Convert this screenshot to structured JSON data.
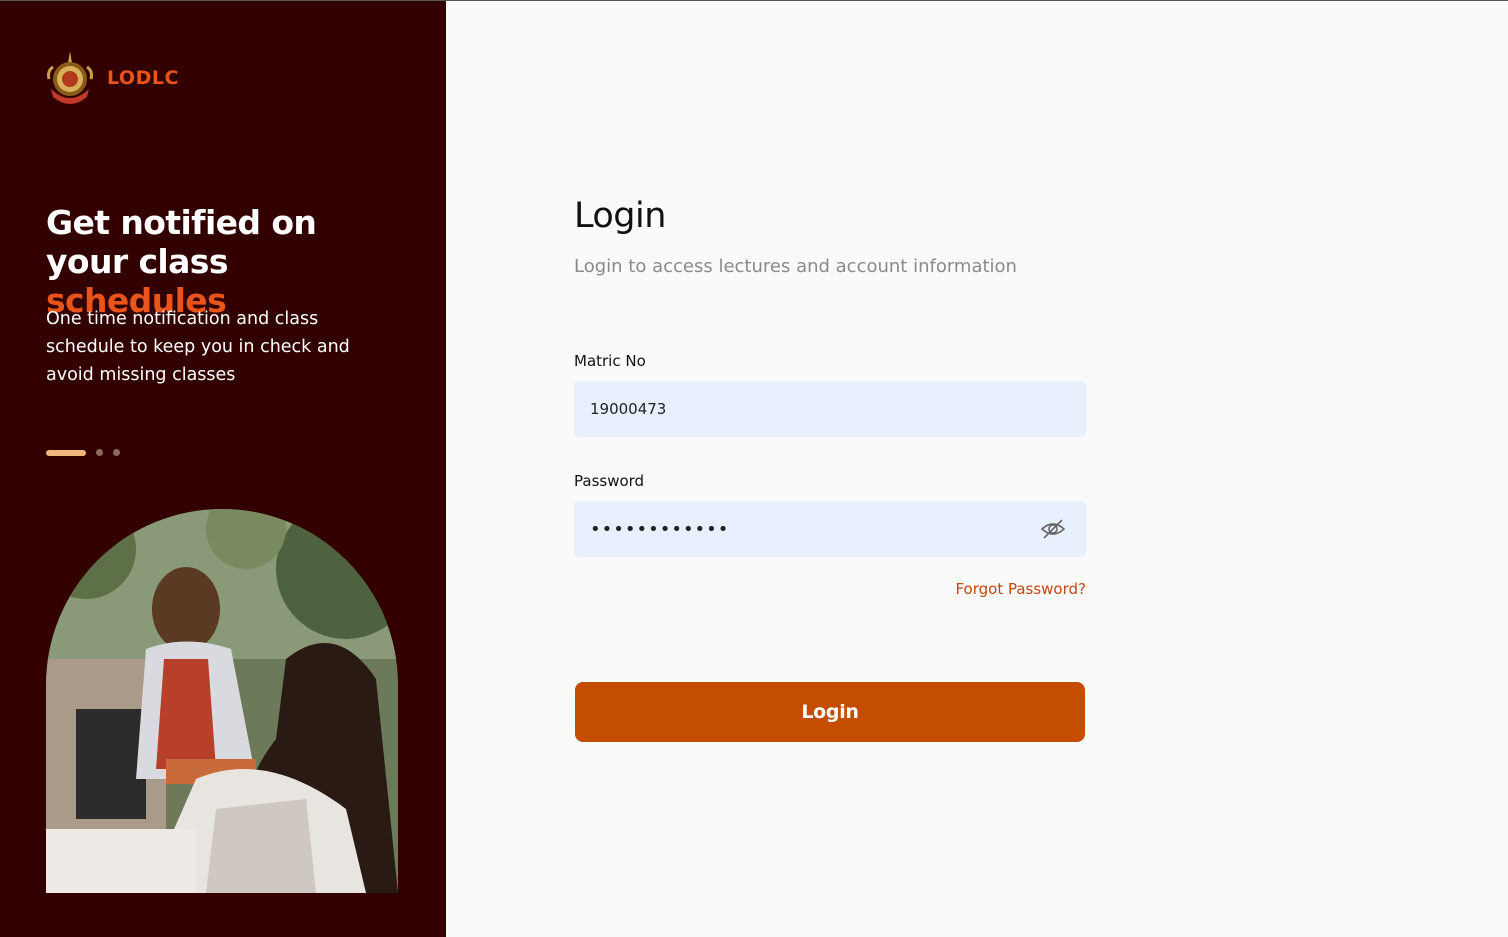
{
  "brand": {
    "name": "LODLC",
    "logo_icon": "crest-logo-icon"
  },
  "hero": {
    "headline_part1": "Get notified on your class ",
    "headline_accent": "schedules",
    "subtext": "One time notification and class schedule to keep you in check and avoid missing classes",
    "carousel": {
      "active_index": 0,
      "count": 3
    }
  },
  "login": {
    "title": "Login",
    "subtitle": "Login to access lectures and account information",
    "matric_label": "Matric No",
    "matric_value": "19000473",
    "password_label": "Password",
    "password_value": "••••••••••••",
    "toggle_icon": "eye-off-icon",
    "forgot_link": "Forgot Password?",
    "submit_label": "Login"
  },
  "colors": {
    "sidebar_bg": "#330000",
    "accent": "#e8541a",
    "button_bg": "#c44d00",
    "input_bg": "#e8f0fe"
  }
}
